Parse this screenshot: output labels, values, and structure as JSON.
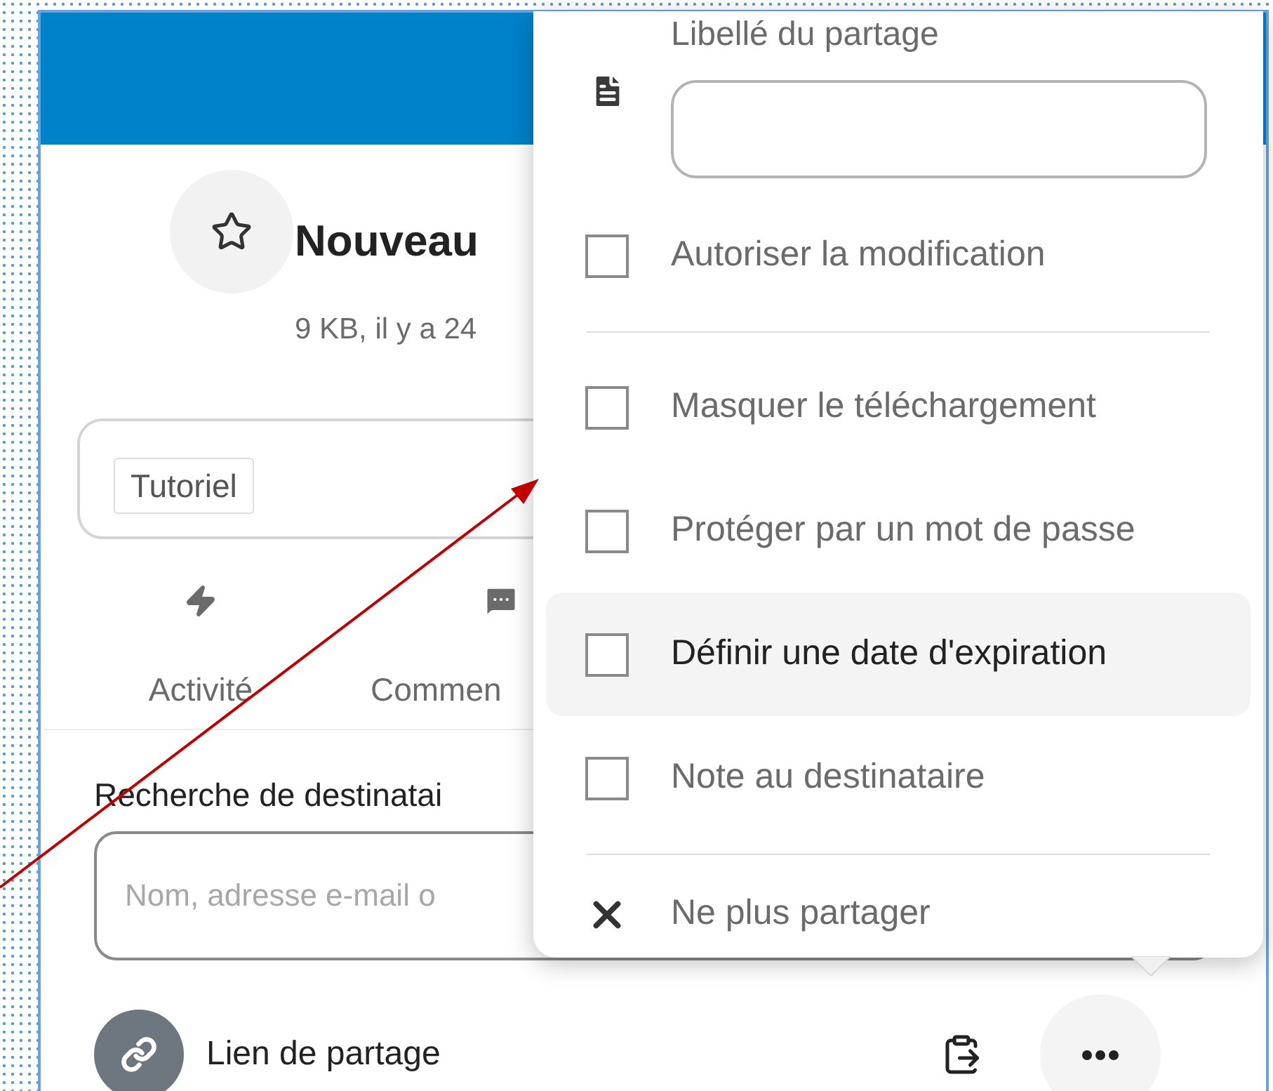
{
  "file": {
    "favorite": false,
    "title": "Nouveau",
    "meta": "9 KB, il y a 24"
  },
  "tags": [
    {
      "label": "Tutoriel"
    }
  ],
  "tabs": [
    {
      "kind": "activity",
      "label": "Activité"
    },
    {
      "kind": "comments",
      "label": "Commen"
    }
  ],
  "search": {
    "label": "Recherche de destinatai",
    "placeholder": "Nom, adresse e-mail o"
  },
  "share_link": {
    "label": "Lien de partage"
  },
  "menu": {
    "label_field": {
      "label": "Libellé du partage"
    },
    "items": [
      {
        "kind": "checkbox",
        "label": "Autoriser la modification",
        "checked": false,
        "highlighted": false
      },
      {
        "kind": "separator"
      },
      {
        "kind": "checkbox",
        "label": "Masquer le téléchargement",
        "checked": false,
        "highlighted": false
      },
      {
        "kind": "checkbox",
        "label": "Protéger par un mot de passe",
        "checked": false,
        "highlighted": false
      },
      {
        "kind": "checkbox",
        "label": "Définir une date d'expiration",
        "checked": false,
        "highlighted": true
      },
      {
        "kind": "checkbox",
        "label": "Note au destinataire",
        "checked": false,
        "highlighted": false
      },
      {
        "kind": "separator"
      },
      {
        "kind": "action",
        "label": "Ne plus partager",
        "highlighted": false
      }
    ]
  }
}
